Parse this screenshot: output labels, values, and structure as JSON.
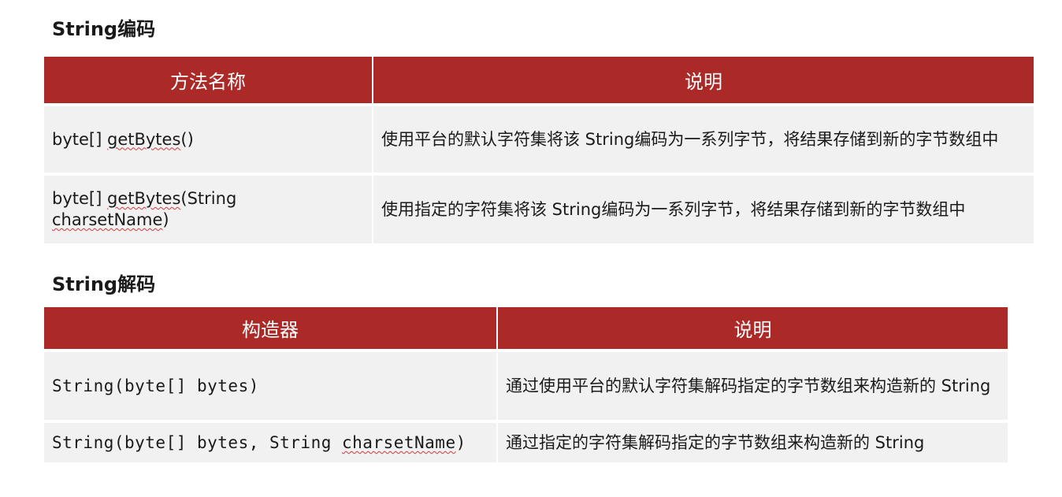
{
  "encode": {
    "title": "String编码",
    "headers": [
      "方法名称",
      "说明"
    ],
    "rows": [
      {
        "method_prefix": "byte[] ",
        "method_name": "getBytes",
        "method_suffix": "()",
        "method_extra": "",
        "desc": "使用平台的默认字符集将该 String编码为一系列字节，将结果存储到新的字节数组中"
      },
      {
        "method_prefix": "byte[] ",
        "method_name": "getBytes",
        "method_suffix": "(String",
        "method_extra": "charsetName",
        "method_extra_suffix": ")",
        "desc": "使用指定的字符集将该 String编码为一系列字节，将结果存储到新的字节数组中"
      }
    ]
  },
  "decode": {
    "title": "String解码",
    "headers": [
      "构造器",
      "说明"
    ],
    "rows": [
      {
        "ctor_prefix": "String(byte[] bytes)",
        "ctor_name": "",
        "ctor_suffix": "",
        "desc": "通过使用平台的默认字符集解码指定的字节数组来构造新的 String"
      },
      {
        "ctor_prefix": "String(byte[] bytes, String ",
        "ctor_name": "charsetName",
        "ctor_suffix": ")",
        "desc": "通过指定的字符集解码指定的字节数组来构造新的 String"
      }
    ]
  }
}
